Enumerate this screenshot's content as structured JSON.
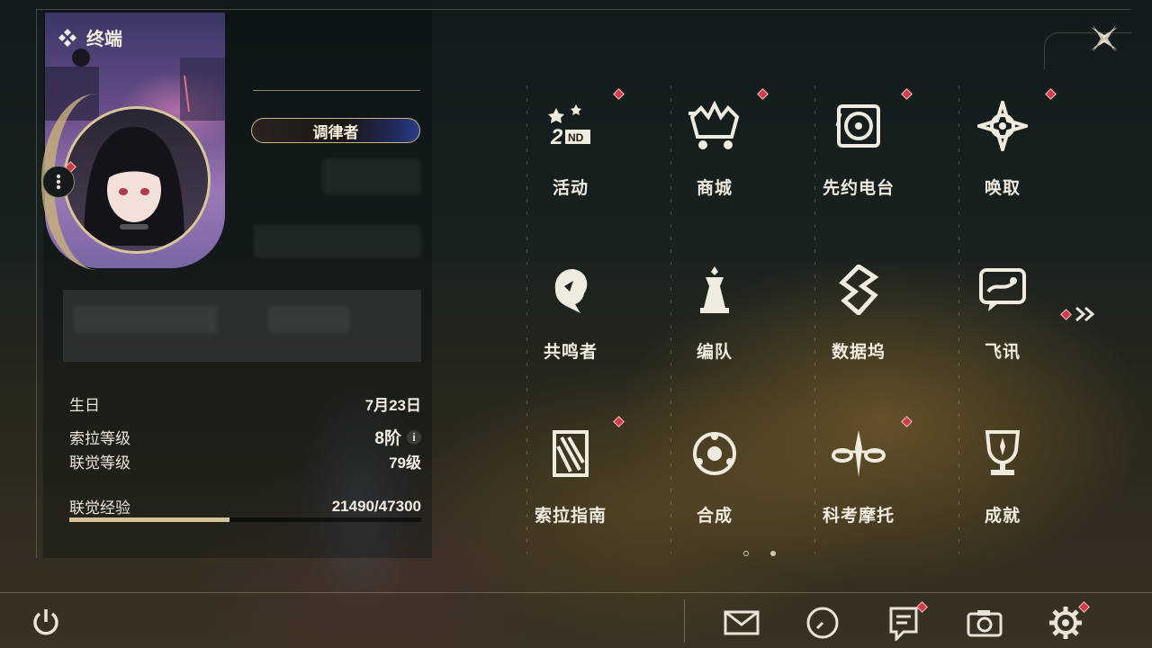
{
  "panel": {
    "title": "终端",
    "player_title": "调律者"
  },
  "stats": [
    {
      "label": "生日",
      "value": "7月23日"
    },
    {
      "label": "索拉等级",
      "value": "8阶"
    },
    {
      "label": "联觉等级",
      "value": "79级"
    }
  ],
  "experience": {
    "label": "联觉经验",
    "value": "21490/47300",
    "progress": 0.454
  },
  "menu": [
    {
      "label": "活动",
      "icon": "event-2nd-anniversary-icon",
      "notify": true
    },
    {
      "label": "商城",
      "icon": "shop-crown-cart-icon",
      "notify": true
    },
    {
      "label": "先约电台",
      "icon": "radio-vinyl-icon",
      "notify": true
    },
    {
      "label": "唤取",
      "icon": "convene-compass-icon",
      "notify": true
    },
    {
      "label": "共鸣者",
      "icon": "resonator-head-icon",
      "notify": false
    },
    {
      "label": "编队",
      "icon": "team-chess-icon",
      "notify": false
    },
    {
      "label": "数据坞",
      "icon": "data-bank-icon",
      "notify": false
    },
    {
      "label": "飞讯",
      "icon": "message-bubble-icon",
      "notify": false
    },
    {
      "label": "索拉指南",
      "icon": "guidebook-icon",
      "notify": true
    },
    {
      "label": "合成",
      "icon": "synthesis-icon",
      "notify": false
    },
    {
      "label": "科考摩托",
      "icon": "motorcycle-icon",
      "notify": true
    },
    {
      "label": "成就",
      "icon": "trophy-icon",
      "notify": false
    }
  ],
  "pager": {
    "current": 1,
    "total": 2
  },
  "bottom_bar": [
    {
      "icon": "mail-icon",
      "notify": false
    },
    {
      "icon": "clock-icon",
      "notify": false
    },
    {
      "icon": "notice-icon",
      "notify": true
    },
    {
      "icon": "camera-icon",
      "notify": false
    },
    {
      "icon": "settings-gear-icon",
      "notify": true
    }
  ],
  "colors": {
    "accent": "#d6c39a",
    "notify": "#d23a45",
    "text": "#f0ebdf"
  }
}
